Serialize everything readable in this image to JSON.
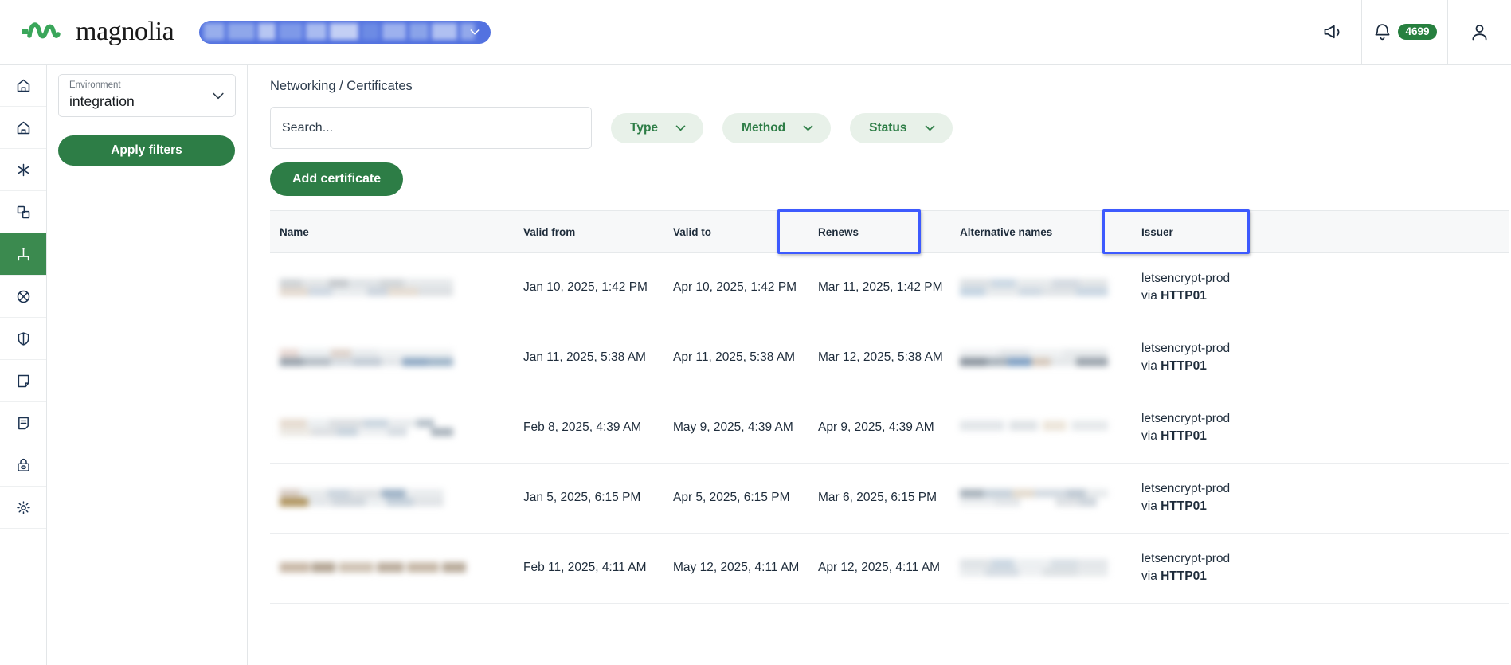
{
  "header": {
    "brand": "magnolia",
    "brand_logo_icon": "magnolia-wave-logo",
    "env_selector_redacted": true,
    "env_selector_chevron_icon": "chevron-down-icon",
    "announcements_icon": "megaphone-icon",
    "notifications_icon": "bell-icon",
    "notifications_count": "4699",
    "account_icon": "user-avatar-icon",
    "badge_color": "#27803f"
  },
  "sidebar": {
    "items": [
      {
        "icon": "home-icon",
        "active": false
      },
      {
        "icon": "home-outline-icon",
        "active": false
      },
      {
        "icon": "asterisk-icon",
        "active": false
      },
      {
        "icon": "layers-stack-icon",
        "active": false
      },
      {
        "icon": "network-topology-icon",
        "active": true
      },
      {
        "icon": "globe-crossed-icon",
        "active": false
      },
      {
        "icon": "shield-icon",
        "active": false
      },
      {
        "icon": "note-bookmark-icon",
        "active": false
      },
      {
        "icon": "document-lines-icon",
        "active": false
      },
      {
        "icon": "lock-eye-icon",
        "active": false
      },
      {
        "icon": "gear-icon",
        "active": false
      }
    ],
    "active_color": "#3b8a4f"
  },
  "filters_panel": {
    "environment": {
      "label": "Environment",
      "value": "integration",
      "chevron_icon": "chevron-down-icon"
    },
    "apply_button": "Apply filters",
    "apply_button_color": "#2d7d46"
  },
  "main": {
    "breadcrumb": "Networking / Certificates",
    "search": {
      "placeholder": "Search...",
      "value": ""
    },
    "filter_chips": [
      {
        "label": "Type",
        "chevron_icon": "chevron-down-icon"
      },
      {
        "label": "Method",
        "chevron_icon": "chevron-down-icon"
      },
      {
        "label": "Status",
        "chevron_icon": "chevron-down-icon"
      }
    ],
    "add_button": "Add certificate",
    "table": {
      "columns": [
        {
          "label": "Name",
          "highlighted": false
        },
        {
          "label": "Valid from",
          "highlighted": false
        },
        {
          "label": "Valid to",
          "highlighted": false
        },
        {
          "label": "Renews",
          "highlighted": true
        },
        {
          "label": "Alternative names",
          "highlighted": false
        },
        {
          "label": "Issuer",
          "highlighted": true
        }
      ],
      "highlight_color": "#3d5afe",
      "rows": [
        {
          "name": "",
          "name_redacted": true,
          "valid_from": "Jan 10, 2025, 1:42 PM",
          "valid_to": "Apr 10, 2025, 1:42 PM",
          "renews": "Mar 11, 2025, 1:42 PM",
          "alt_names": "",
          "alt_names_redacted": true,
          "issuer": "letsencrypt-prod",
          "issuer_via_prefix": "via ",
          "issuer_method": "HTTP01"
        },
        {
          "name": "",
          "name_redacted": true,
          "valid_from": "Jan 11, 2025, 5:38 AM",
          "valid_to": "Apr 11, 2025, 5:38 AM",
          "renews": "Mar 12, 2025, 5:38 AM",
          "alt_names": "",
          "alt_names_redacted": true,
          "issuer": "letsencrypt-prod",
          "issuer_via_prefix": "via ",
          "issuer_method": "HTTP01"
        },
        {
          "name": "",
          "name_redacted": true,
          "valid_from": "Feb 8, 2025, 4:39 AM",
          "valid_to": "May 9, 2025, 4:39 AM",
          "renews": "Apr 9, 2025, 4:39 AM",
          "alt_names": "",
          "alt_names_redacted": true,
          "issuer": "letsencrypt-prod",
          "issuer_via_prefix": "via ",
          "issuer_method": "HTTP01"
        },
        {
          "name": "",
          "name_redacted": true,
          "valid_from": "Jan 5, 2025, 6:15 PM",
          "valid_to": "Apr 5, 2025, 6:15 PM",
          "renews": "Mar 6, 2025, 6:15 PM",
          "alt_names": "",
          "alt_names_redacted": true,
          "issuer": "letsencrypt-prod",
          "issuer_via_prefix": "via ",
          "issuer_method": "HTTP01"
        },
        {
          "name": "",
          "name_redacted": true,
          "valid_from": "Feb 11, 2025, 4:11 AM",
          "valid_to": "May 12, 2025, 4:11 AM",
          "renews": "Apr 12, 2025, 4:11 AM",
          "alt_names": "",
          "alt_names_redacted": true,
          "issuer": "letsencrypt-prod",
          "issuer_via_prefix": "via ",
          "issuer_method": "HTTP01"
        }
      ]
    }
  }
}
